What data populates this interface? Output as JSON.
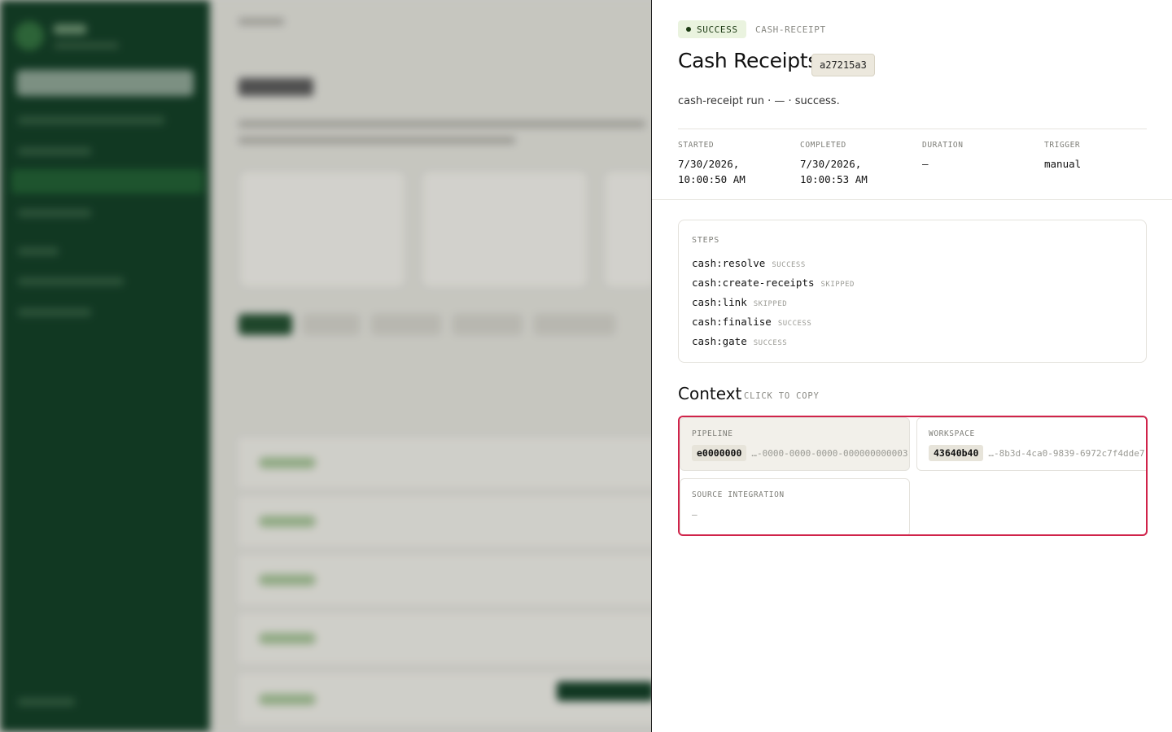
{
  "drawer": {
    "status": "SUCCESS",
    "kind": "CASH-RECEIPT",
    "title": "Cash Receipts",
    "run_id": "a27215a3",
    "description": "cash-receipt run · — · success.",
    "meta": [
      {
        "label": "STARTED",
        "value": "7/30/2026,\n10:00:50 AM"
      },
      {
        "label": "COMPLETED",
        "value": "7/30/2026,\n10:00:53 AM"
      },
      {
        "label": "DURATION",
        "value": "—"
      },
      {
        "label": "TRIGGER",
        "value": "manual"
      }
    ],
    "steps_label": "STEPS",
    "steps": [
      {
        "name": "cash:resolve",
        "status": "SUCCESS"
      },
      {
        "name": "cash:create-receipts",
        "status": "SKIPPED"
      },
      {
        "name": "cash:link",
        "status": "SKIPPED"
      },
      {
        "name": "cash:finalise",
        "status": "SUCCESS"
      },
      {
        "name": "cash:gate",
        "status": "SUCCESS"
      }
    ],
    "context_title": "Context",
    "context_hint": "CLICK TO COPY",
    "context": {
      "pipeline": {
        "label": "PIPELINE",
        "chip": "e0000000",
        "rest": "…-0000-0000-0000-000000000003"
      },
      "workspace": {
        "label": "WORKSPACE",
        "chip": "43640b40",
        "rest": "…-8b3d-4ca0-9839-6972c7f4dde7"
      },
      "source_integration": {
        "label": "SOURCE INTEGRATION",
        "value": "—"
      }
    }
  },
  "colors": {
    "sidebar": "#0f3a22",
    "status_bg": "#eaf3df",
    "status_fg": "#1d3b14",
    "highlight": "#d0234a"
  }
}
